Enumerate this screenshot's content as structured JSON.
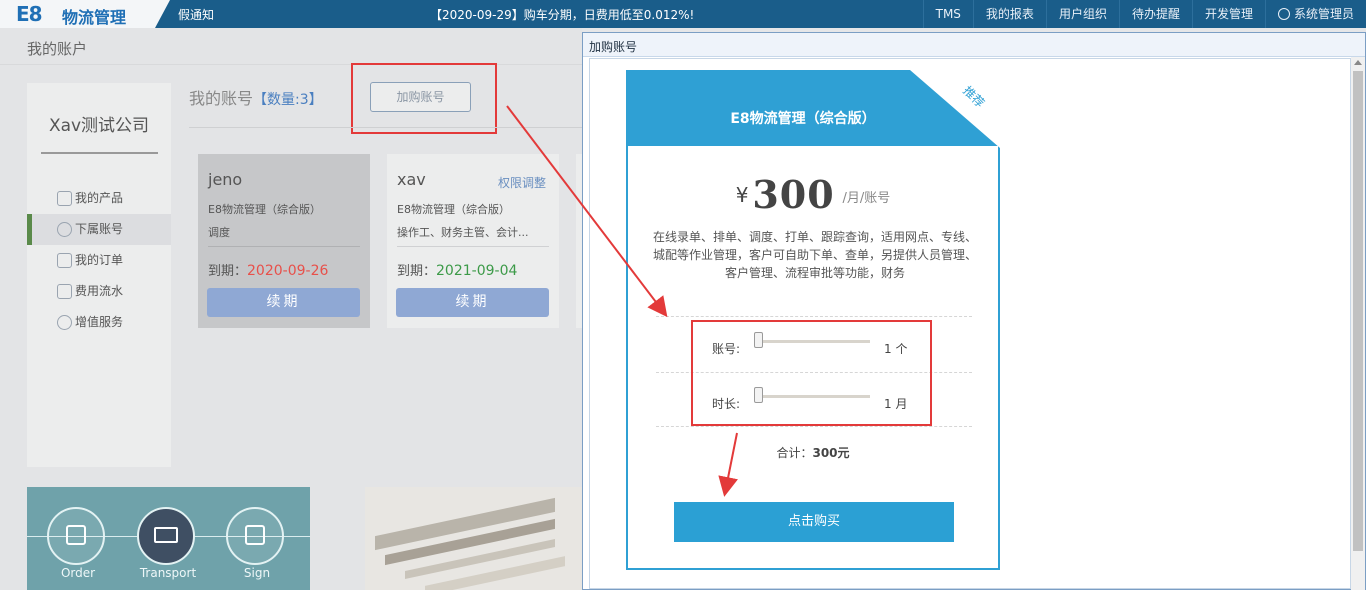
{
  "topbar": {
    "logo_mark": "E8",
    "logo_text": "物流管理",
    "notice_left": "假通知",
    "notice_mid": "【2020-09-29】购车分期，日费用低至0.012%!",
    "nav": [
      "TMS",
      "我的报表",
      "用户组织",
      "待办提醒",
      "开发管理"
    ],
    "user": "系统管理员"
  },
  "page": {
    "title": "我的账户",
    "company": "Xav测试公司",
    "menu": [
      {
        "label": "我的产品",
        "icon": "cube-icon"
      },
      {
        "label": "下属账号",
        "icon": "user-icon"
      },
      {
        "label": "我的订单",
        "icon": "document-icon"
      },
      {
        "label": "费用流水",
        "icon": "wallet-icon"
      },
      {
        "label": "增值服务",
        "icon": "wave-icon"
      }
    ],
    "accounts_heading": "我的账号",
    "accounts_count": "【数量:3】",
    "buy_button": "加购账号",
    "cards": [
      {
        "name": "jeno",
        "product": "E8物流管理（综合版）",
        "role": "调度",
        "expiry_label": "到期：",
        "expiry": "2020-09-26",
        "renew": "续期"
      },
      {
        "name": "xav",
        "permission": "权限调整",
        "product": "E8物流管理（综合版）",
        "role": "操作工、财务主管、会计...",
        "expiry_label": "到期：",
        "expiry": "2021-09-04",
        "renew": "续期"
      }
    ],
    "banner_labels": [
      "Order",
      "Transport",
      "Sign"
    ]
  },
  "modal": {
    "title": "加购账号",
    "plan_name": "E8物流管理（综合版）",
    "ribbon": "推荐",
    "currency": "¥",
    "price": "300",
    "unit": "/月/账号",
    "description": "在线录单、排单、调度、打单、跟踪查询，适用网点、专线、城配等作业管理，客户可自助下单、查单，另提供人员管理、客户管理、流程审批等功能，财务",
    "account_label": "账号:",
    "account_value": "1 个",
    "duration_label": "时长:",
    "duration_value": "1 月",
    "total_label": "合计：",
    "total_value": "300元",
    "purchase_button": "点击购买"
  },
  "colors": {
    "topbar": "#1a5d8a",
    "accent": "#2fa0d4",
    "annotation_red": "#e33a3a",
    "expired_red": "#e8504a",
    "valid_green": "#3c9a48"
  }
}
